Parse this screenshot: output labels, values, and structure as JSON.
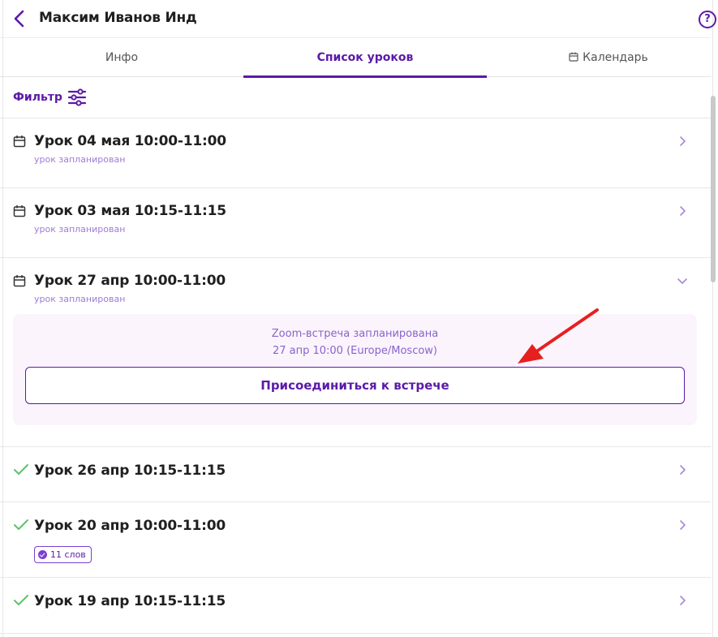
{
  "header": {
    "title": "Максим Иванов Инд",
    "help_label": "?"
  },
  "tabs": [
    {
      "label": "Инфо"
    },
    {
      "label": "Список уроков"
    },
    {
      "label": "Календарь"
    }
  ],
  "filter": {
    "label": "Фильтр"
  },
  "lessons": [
    {
      "title": "Урок 04 мая 10:00-11:00",
      "status": "урок запланирован",
      "icon": "calendar-icon"
    },
    {
      "title": "Урок 03 мая 10:15-11:15",
      "status": "урок запланирован",
      "icon": "calendar-icon"
    },
    {
      "title": "Урок 27 апр 10:00-11:00",
      "status": "урок запланирован",
      "icon": "calendar-icon",
      "expanded": true
    },
    {
      "title": "Урок 26 апр 10:15-11:15",
      "icon": "check-icon"
    },
    {
      "title": "Урок 20 апр 10:00-11:00",
      "icon": "check-icon",
      "badge": "11 слов"
    },
    {
      "title": "Урок 19 апр 10:15-11:15",
      "icon": "check-icon"
    }
  ],
  "meeting": {
    "line1": "Zoom-встреча запланирована",
    "line2": "27 апр 10:00 (Europe/Moscow)",
    "join_label": "Присоединиться к встрече"
  },
  "colors": {
    "accent": "#5b1aa8",
    "status": "#a07ad6",
    "check": "#5cc36b",
    "arrow": "#e5201f",
    "meeting_bg": "#fbf4fd"
  }
}
